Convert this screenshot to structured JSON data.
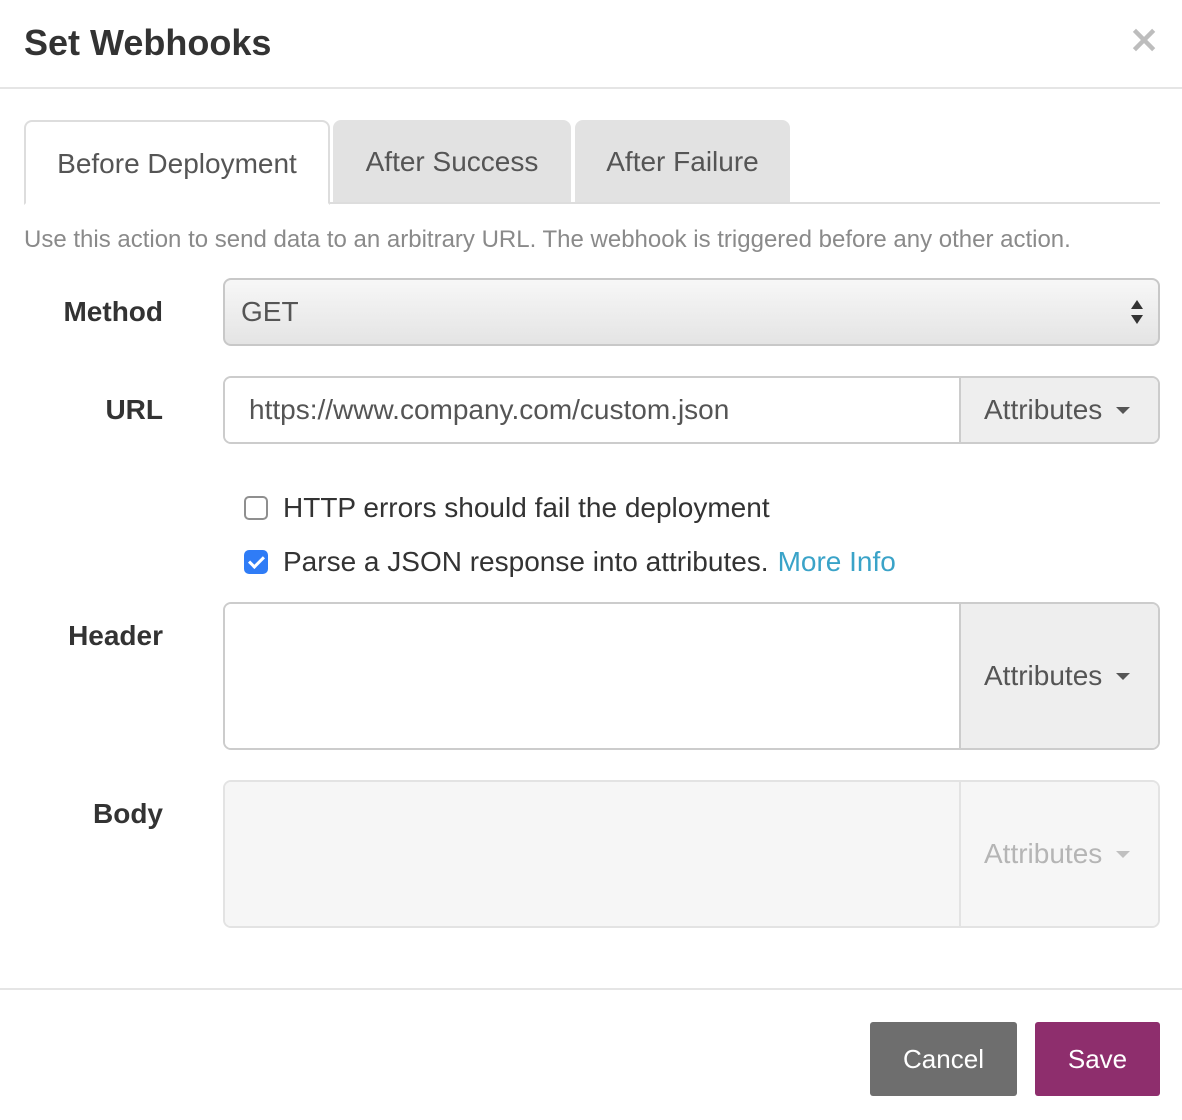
{
  "modal": {
    "title": "Set Webhooks",
    "close_glyph": "×"
  },
  "tabs": [
    {
      "label": "Before Deployment",
      "active": true
    },
    {
      "label": "After Success",
      "active": false
    },
    {
      "label": "After Failure",
      "active": false
    }
  ],
  "help_text": "Use this action to send data to an arbitrary URL. The webhook is triggered before any other action.",
  "form": {
    "method": {
      "label": "Method",
      "value": "GET"
    },
    "url": {
      "label": "URL",
      "value": "https://www.company.com/custom.json",
      "addon_label": "Attributes"
    },
    "checkboxes": [
      {
        "label": "HTTP errors should fail the deployment",
        "checked": false
      },
      {
        "label": "Parse a JSON response into attributes.",
        "checked": true,
        "link": "More Info"
      }
    ],
    "header": {
      "label": "Header",
      "value": "",
      "addon_label": "Attributes"
    },
    "body": {
      "label": "Body",
      "value": "",
      "addon_label": "Attributes",
      "disabled": true
    }
  },
  "footer": {
    "cancel_label": "Cancel",
    "save_label": "Save"
  },
  "colors": {
    "save": "#8e2e6d",
    "cancel": "#6e6e6e",
    "link": "#3aa3c8",
    "checkbox_checked": "#2f7cf6"
  }
}
